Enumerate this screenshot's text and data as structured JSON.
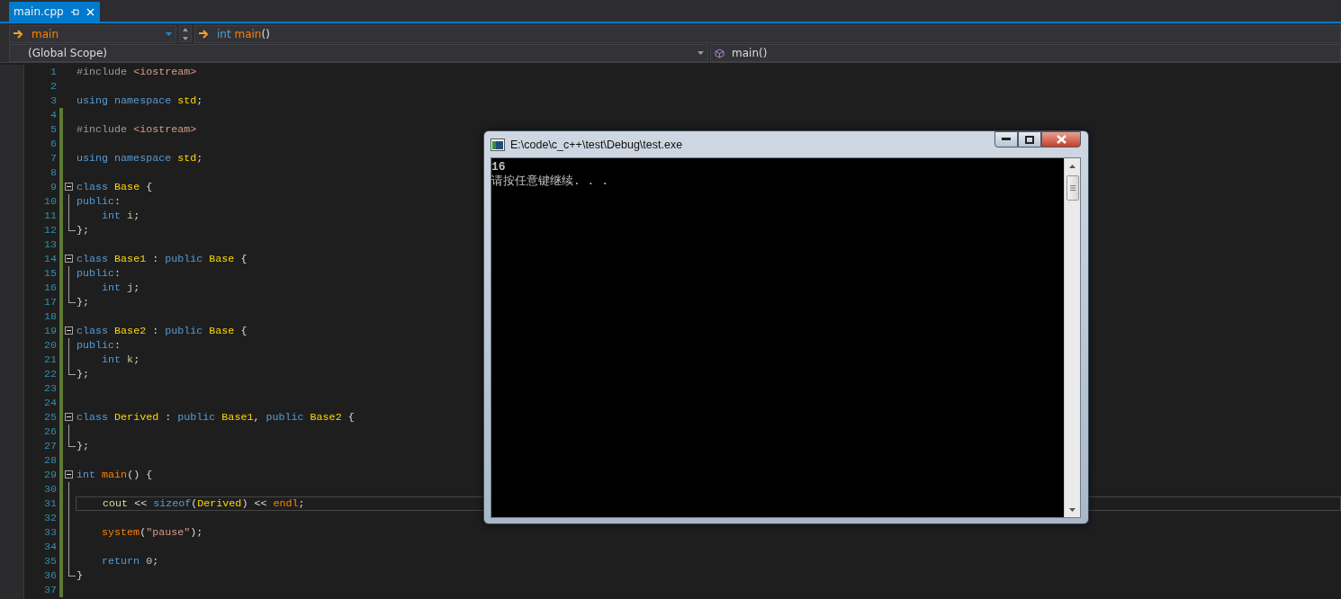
{
  "tabs": [
    {
      "label": "main.cpp",
      "selected": true,
      "pinned": false
    }
  ],
  "nav": {
    "project": "main",
    "member_tokens": [
      {
        "kind": "kw",
        "text": "int "
      },
      {
        "kind": "fn",
        "text": "main"
      },
      {
        "kind": "punc",
        "text": "()"
      }
    ],
    "scope": "(Global Scope)",
    "function": "main()"
  },
  "editor": {
    "lines": [
      {
        "number": "1",
        "changed": false,
        "current": false,
        "kind": "plain",
        "tokens": [
          {
            "kind": "pre",
            "text": "#include "
          },
          {
            "kind": "inc",
            "text": "<iostream>"
          }
        ]
      },
      {
        "number": "2",
        "changed": false,
        "current": false,
        "kind": "plain"
      },
      {
        "number": "3",
        "changed": false,
        "current": false,
        "kind": "plain",
        "tokens": [
          {
            "kind": "kw",
            "text": "using namespace "
          },
          {
            "kind": "type",
            "text": "std"
          },
          {
            "kind": "punc",
            "text": ";"
          }
        ]
      },
      {
        "number": "4",
        "changed": true,
        "current": false,
        "kind": "plain"
      },
      {
        "number": "5",
        "changed": true,
        "current": false,
        "kind": "plain",
        "tokens": [
          {
            "kind": "pre",
            "text": "#include "
          },
          {
            "kind": "inc",
            "text": "<iostream>"
          }
        ]
      },
      {
        "number": "6",
        "changed": true,
        "current": false,
        "kind": "plain"
      },
      {
        "number": "7",
        "changed": true,
        "current": false,
        "kind": "plain",
        "tokens": [
          {
            "kind": "kw",
            "text": "using namespace "
          },
          {
            "kind": "type",
            "text": "std"
          },
          {
            "kind": "punc",
            "text": ";"
          }
        ]
      },
      {
        "number": "8",
        "changed": true,
        "current": false,
        "kind": "plain"
      },
      {
        "number": "9",
        "changed": true,
        "current": false,
        "kind": "header",
        "tokens": [
          {
            "kind": "kw",
            "text": "class "
          },
          {
            "kind": "type",
            "text": "Base"
          },
          {
            "kind": "punc",
            "text": " {"
          }
        ]
      },
      {
        "number": "10",
        "changed": true,
        "current": false,
        "kind": "body",
        "tokens": [
          {
            "kind": "kw",
            "text": "public"
          },
          {
            "kind": "punc",
            "text": ":"
          }
        ]
      },
      {
        "number": "11",
        "changed": true,
        "current": false,
        "kind": "body",
        "tokens": [
          {
            "kind": "kw",
            "text": "    int "
          },
          {
            "kind": "var",
            "text": "i"
          },
          {
            "kind": "punc",
            "text": ";"
          }
        ]
      },
      {
        "number": "12",
        "changed": true,
        "current": false,
        "kind": "last",
        "tokens": [
          {
            "kind": "punc",
            "text": "};"
          }
        ]
      },
      {
        "number": "13",
        "changed": true,
        "current": false,
        "kind": "plain"
      },
      {
        "number": "14",
        "changed": true,
        "current": false,
        "kind": "header",
        "tokens": [
          {
            "kind": "kw",
            "text": "class "
          },
          {
            "kind": "type",
            "text": "Base1"
          },
          {
            "kind": "punc",
            "text": " : "
          },
          {
            "kind": "kw",
            "text": "public "
          },
          {
            "kind": "type",
            "text": "Base"
          },
          {
            "kind": "punc",
            "text": " {"
          }
        ]
      },
      {
        "number": "15",
        "changed": true,
        "current": false,
        "kind": "body",
        "tokens": [
          {
            "kind": "kw",
            "text": "public"
          },
          {
            "kind": "punc",
            "text": ":"
          }
        ]
      },
      {
        "number": "16",
        "changed": true,
        "current": false,
        "kind": "body",
        "tokens": [
          {
            "kind": "kw",
            "text": "    int "
          },
          {
            "kind": "var",
            "text": "j"
          },
          {
            "kind": "punc",
            "text": ";"
          }
        ]
      },
      {
        "number": "17",
        "changed": true,
        "current": false,
        "kind": "last",
        "tokens": [
          {
            "kind": "punc",
            "text": "};"
          }
        ]
      },
      {
        "number": "18",
        "changed": true,
        "current": false,
        "kind": "plain"
      },
      {
        "number": "19",
        "changed": true,
        "current": false,
        "kind": "header",
        "tokens": [
          {
            "kind": "kw",
            "text": "class "
          },
          {
            "kind": "type",
            "text": "Base2"
          },
          {
            "kind": "punc",
            "text": " : "
          },
          {
            "kind": "kw",
            "text": "public "
          },
          {
            "kind": "type",
            "text": "Base"
          },
          {
            "kind": "punc",
            "text": " {"
          }
        ]
      },
      {
        "number": "20",
        "changed": true,
        "current": false,
        "kind": "body",
        "tokens": [
          {
            "kind": "kw",
            "text": "public"
          },
          {
            "kind": "punc",
            "text": ":"
          }
        ]
      },
      {
        "number": "21",
        "changed": true,
        "current": false,
        "kind": "body",
        "tokens": [
          {
            "kind": "kw",
            "text": "    int "
          },
          {
            "kind": "var",
            "text": "k"
          },
          {
            "kind": "punc",
            "text": ";"
          }
        ]
      },
      {
        "number": "22",
        "changed": true,
        "current": false,
        "kind": "last",
        "tokens": [
          {
            "kind": "punc",
            "text": "};"
          }
        ]
      },
      {
        "number": "23",
        "changed": true,
        "current": false,
        "kind": "plain"
      },
      {
        "number": "24",
        "changed": true,
        "current": false,
        "kind": "plain"
      },
      {
        "number": "25",
        "changed": true,
        "current": false,
        "kind": "header",
        "tokens": [
          {
            "kind": "kw",
            "text": "class "
          },
          {
            "kind": "type",
            "text": "Derived"
          },
          {
            "kind": "punc",
            "text": " : "
          },
          {
            "kind": "kw",
            "text": "public "
          },
          {
            "kind": "type",
            "text": "Base1"
          },
          {
            "kind": "punc",
            "text": ", "
          },
          {
            "kind": "kw",
            "text": "public "
          },
          {
            "kind": "type",
            "text": "Base2"
          },
          {
            "kind": "punc",
            "text": " {"
          }
        ]
      },
      {
        "number": "26",
        "changed": true,
        "current": false,
        "kind": "body"
      },
      {
        "number": "27",
        "changed": true,
        "current": false,
        "kind": "last",
        "tokens": [
          {
            "kind": "punc",
            "text": "};"
          }
        ]
      },
      {
        "number": "28",
        "changed": true,
        "current": false,
        "kind": "plain"
      },
      {
        "number": "29",
        "changed": true,
        "current": false,
        "kind": "header",
        "tokens": [
          {
            "kind": "kw",
            "text": "int "
          },
          {
            "kind": "fn",
            "text": "main"
          },
          {
            "kind": "punc",
            "text": "() {"
          }
        ]
      },
      {
        "number": "30",
        "changed": true,
        "current": false,
        "kind": "body"
      },
      {
        "number": "31",
        "changed": true,
        "current": true,
        "kind": "body",
        "tokens": [
          {
            "kind": "var2",
            "text": "    cout "
          },
          {
            "kind": "punc",
            "text": "<< "
          },
          {
            "kind": "kw",
            "text": "sizeof"
          },
          {
            "kind": "punc",
            "text": "("
          },
          {
            "kind": "type",
            "text": "Derived"
          },
          {
            "kind": "punc",
            "text": ") << "
          },
          {
            "kind": "fn",
            "text": "endl"
          },
          {
            "kind": "punc",
            "text": ";"
          }
        ]
      },
      {
        "number": "32",
        "changed": true,
        "current": false,
        "kind": "body"
      },
      {
        "number": "33",
        "changed": true,
        "current": false,
        "kind": "body",
        "tokens": [
          {
            "kind": "fn",
            "text": "    system"
          },
          {
            "kind": "punc",
            "text": "("
          },
          {
            "kind": "str",
            "text": "\"pause\""
          },
          {
            "kind": "punc",
            "text": ");"
          }
        ]
      },
      {
        "number": "34",
        "changed": true,
        "current": false,
        "kind": "body"
      },
      {
        "number": "35",
        "changed": true,
        "current": false,
        "kind": "body",
        "tokens": [
          {
            "kind": "kw",
            "text": "    return "
          },
          {
            "kind": "num",
            "text": "0"
          },
          {
            "kind": "punc",
            "text": ";"
          }
        ]
      },
      {
        "number": "36",
        "changed": true,
        "current": false,
        "kind": "last",
        "tokens": [
          {
            "kind": "punc",
            "text": "}"
          }
        ]
      },
      {
        "number": "37",
        "changed": true,
        "current": false,
        "kind": "plain"
      }
    ]
  },
  "console": {
    "title": "E:\\code\\c_c++\\test\\Debug\\test.exe",
    "output": [
      "16",
      "请按任意键继续. . ."
    ]
  }
}
